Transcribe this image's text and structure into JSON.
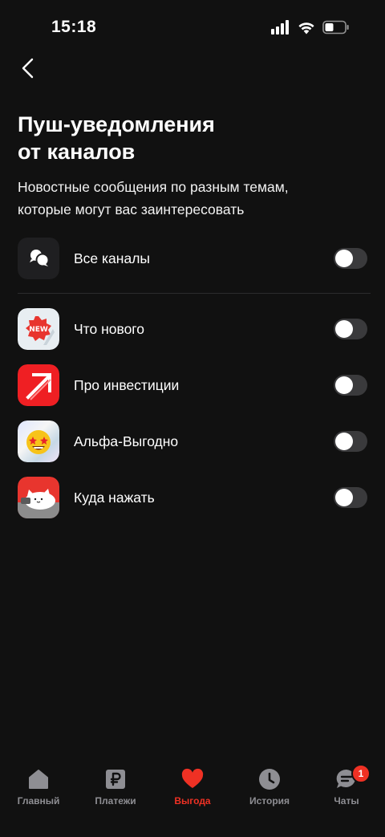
{
  "status_bar": {
    "time": "15:18",
    "icons": [
      "cellular-icon",
      "wifi-icon",
      "battery-icon"
    ]
  },
  "header": {
    "back_icon": "chevron-left-icon",
    "title": "Пуш-уведомления\nот каналов",
    "subtitle": "Новостные сообщения по разным темам,\nкоторые могут вас заинтересовать"
  },
  "all_channels": {
    "label": "Все каналы",
    "icon": "chat-bubbles-icon",
    "enabled": false
  },
  "channels": [
    {
      "label": "Что нового",
      "icon": "new-badge-icon",
      "enabled": false
    },
    {
      "label": "Про инвестиции",
      "icon": "investment-arrow-icon",
      "enabled": false
    },
    {
      "label": "Альфа-Выгодно",
      "icon": "star-eyes-emoji-icon",
      "enabled": false
    },
    {
      "label": "Куда нажать",
      "icon": "cat-sticker-icon",
      "enabled": false
    }
  ],
  "tab_bar": {
    "tabs": [
      {
        "label": "Главный",
        "icon": "home-icon",
        "active": false
      },
      {
        "label": "Платежи",
        "icon": "ruble-icon",
        "active": false
      },
      {
        "label": "Выгода",
        "icon": "heart-icon",
        "active": true
      },
      {
        "label": "История",
        "icon": "clock-icon",
        "active": false
      },
      {
        "label": "Чаты",
        "icon": "chat-icon",
        "active": false,
        "badge": "1"
      }
    ]
  },
  "colors": {
    "background": "#111111",
    "accent": "#ef3124",
    "toggle_off": "#3a3a3c",
    "tab_inactive": "#8e8e93"
  }
}
